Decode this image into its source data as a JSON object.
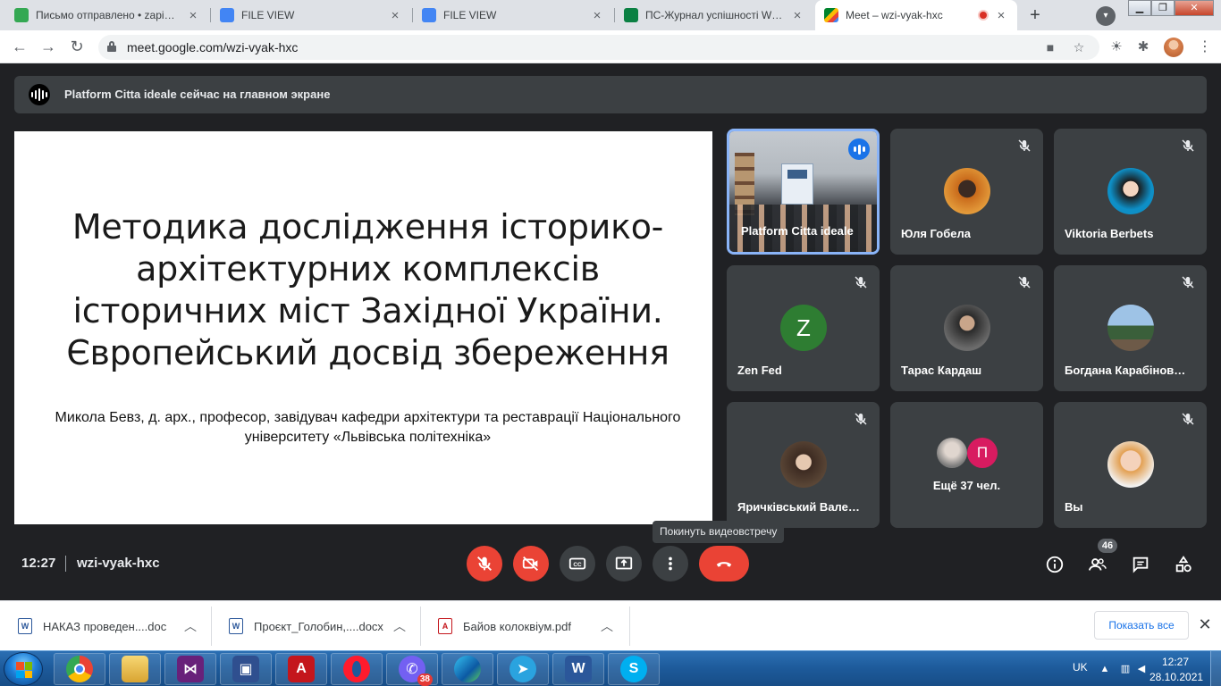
{
  "browser": {
    "tabs": [
      {
        "title": "Письмо отправлено • zapib@",
        "active": false
      },
      {
        "title": "FILE VIEW",
        "active": false
      },
      {
        "title": "FILE VIEW",
        "active": false
      },
      {
        "title": "ПС-Журнал успішності WEB",
        "active": false
      },
      {
        "title": "Meet – wzi-vyak-hxc",
        "active": true
      }
    ],
    "new_tab": "+",
    "url": "meet.google.com/wzi-vyak-hxc"
  },
  "meet": {
    "presentation_banner": "Platform Citta ideale сейчас на главном экране",
    "slide": {
      "title": "Методика дослідження історико-архітектурних комплексів історичних міст Західної України. Європейський досвід збереження",
      "subtitle": "Микола Бевз, д. арх., професор, завідувач кафедри архітектури та реставрації Національного університету «Львівська політехніка»"
    },
    "participants": [
      {
        "name": "Platform Citta ideale",
        "type": "video"
      },
      {
        "name": "Юля Гобела",
        "type": "photo"
      },
      {
        "name": "Viktoria Berbets",
        "type": "photo"
      },
      {
        "name": "Zen Fed",
        "type": "letter",
        "letter": "Z"
      },
      {
        "name": "Тарас Кардаш",
        "type": "photo"
      },
      {
        "name": "Богдана Карабінов…",
        "type": "photo"
      },
      {
        "name": "Яричківський Вале…",
        "type": "photo"
      },
      {
        "name": "Ещё 37 чел.",
        "type": "more",
        "letter": "П"
      },
      {
        "name": "Вы",
        "type": "photo"
      }
    ],
    "tooltip": "Покинуть видеовстречу",
    "time": "12:27",
    "meeting_code": "wzi-vyak-hxc",
    "participant_count": "46"
  },
  "downloads": {
    "items": [
      {
        "name": "НАКАЗ проведен....doc",
        "type": "word"
      },
      {
        "name": "Проєкт_Голобин,....docx",
        "type": "word"
      },
      {
        "name": "Байов колоквіум.pdf",
        "type": "pdf"
      }
    ],
    "show_all": "Показать все"
  },
  "taskbar": {
    "language": "UK",
    "time": "12:27",
    "date": "28.10.2021",
    "viber_badge": "38"
  }
}
